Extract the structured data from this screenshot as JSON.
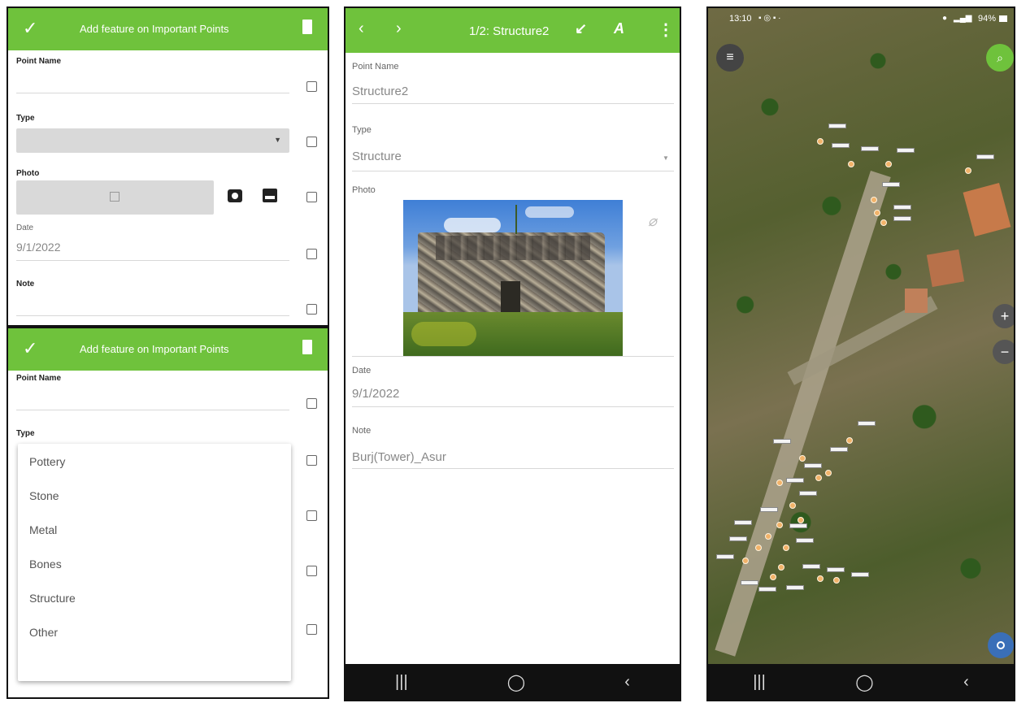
{
  "form_panel_a": {
    "title": "Add feature on Important Points",
    "fields": [
      {
        "label": "Point Name",
        "value": ""
      },
      {
        "label": "Type",
        "value": ""
      },
      {
        "label": "Photo",
        "value": ""
      },
      {
        "label": "Date",
        "value": "9/1/2022"
      },
      {
        "label": "Note",
        "value": ""
      }
    ]
  },
  "form_panel_b": {
    "title": "Add feature on Important Points",
    "fields": [
      {
        "label": "Point Name"
      },
      {
        "label": "Type"
      }
    ],
    "type_options": [
      "Pottery",
      "Stone",
      "Metal",
      "Bones",
      "Structure",
      "Other"
    ]
  },
  "detail_panel": {
    "title": "1/2: Structure2",
    "point_name_label": "Point Name",
    "point_name_value": "Structure2",
    "type_label": "Type",
    "type_value": "Structure",
    "photo_label": "Photo",
    "date_label": "Date",
    "date_value": "9/1/2022",
    "note_label": "Note",
    "note_value": "Burj(Tower)_Asur"
  },
  "map_panel": {
    "status_time": "13:10",
    "status_right": "94%"
  },
  "colors": {
    "accent_green": "#6fc23c",
    "nav_dark": "#111111",
    "marker_orange": "#f2b36a"
  }
}
